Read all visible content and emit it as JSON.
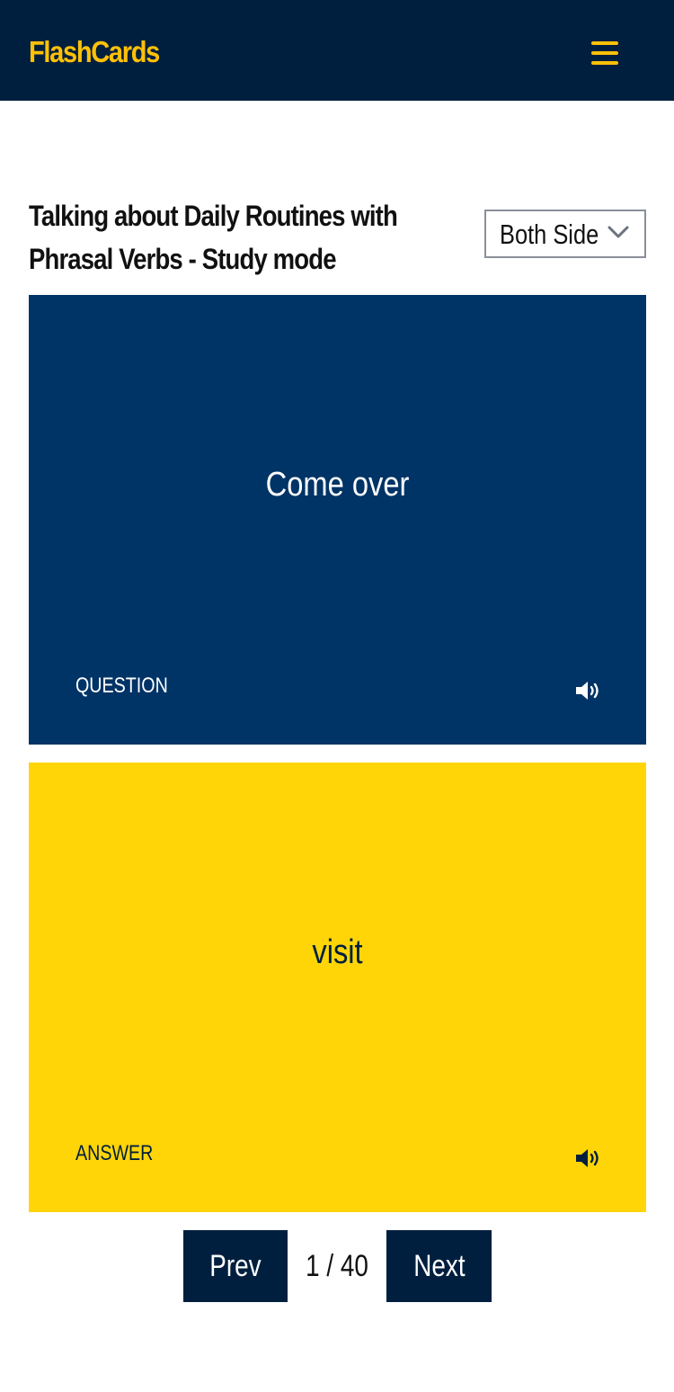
{
  "colors": {
    "header_bg": "#001f3f",
    "brand": "#ffc107",
    "question_card_bg": "#003366",
    "question_card_text": "#ffffff",
    "answer_card_bg": "#ffd507",
    "answer_card_text": "#001f3f",
    "button_bg": "#001f3f",
    "button_text": "#ffffff"
  },
  "header": {
    "brand": "FlashCards",
    "menu_icon": "hamburger-icon"
  },
  "page": {
    "title": "Talking about Daily Routines with Phrasal Verbs - Study mode"
  },
  "side_select": {
    "value": "Both Side",
    "icon": "chevron-down-icon"
  },
  "cards": {
    "question": {
      "text": "Come over",
      "label": "QUESTION",
      "icon": "speaker-icon"
    },
    "answer": {
      "text": "visit",
      "label": "ANSWER",
      "icon": "speaker-icon"
    }
  },
  "pager": {
    "prev_label": "Prev",
    "indicator": "1 / 40",
    "next_label": "Next"
  }
}
